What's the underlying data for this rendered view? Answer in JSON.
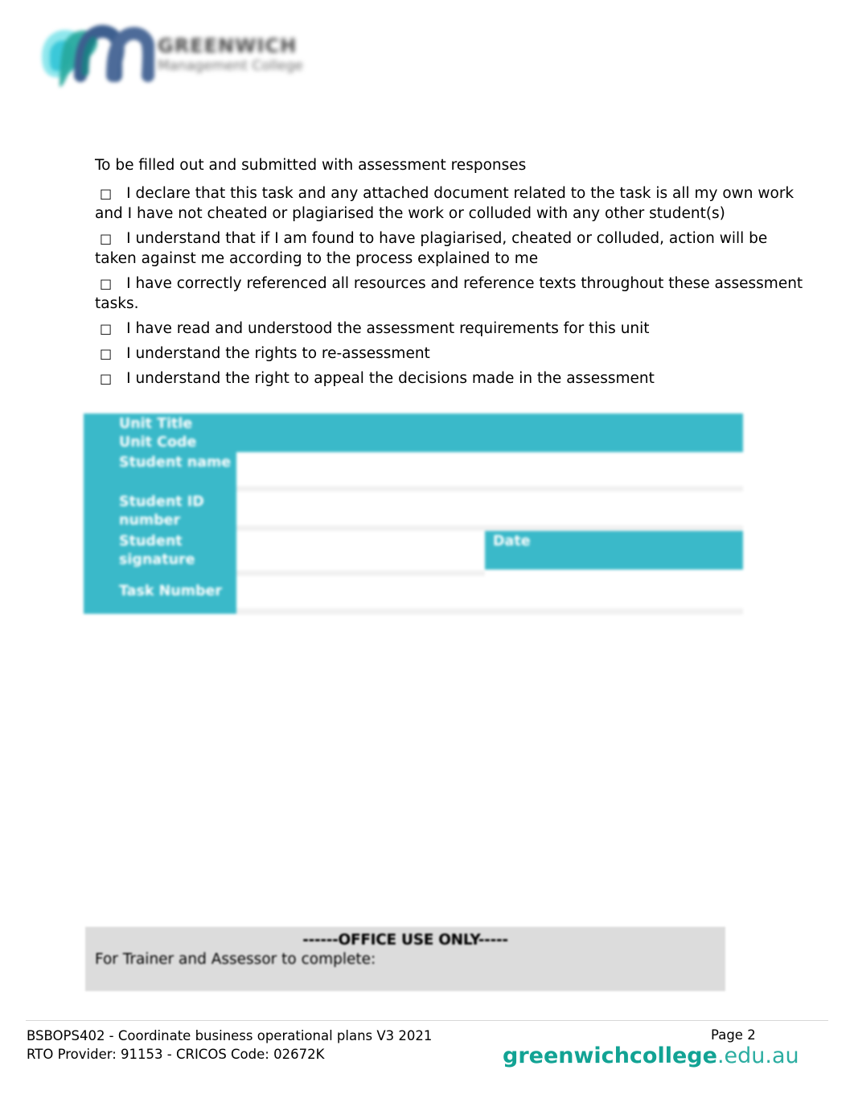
{
  "logo": {
    "mark_icon": "greenwich-gm-monogram-icon",
    "wordmark_top": "GREENWICH",
    "wordmark_bottom": "Management College",
    "colors": {
      "cyan": "#3fd2e0",
      "teal": "#2aa79b",
      "navy": "#49618c"
    }
  },
  "declaration": {
    "intro": "To be filled out and submitted with assessment responses",
    "checkbox_glyph": "□",
    "items": [
      "I declare that this task and any attached document related to the task is all my own work and I have not cheated or plagiarised the work or colluded with any other student(s)",
      "I understand that if I am found to have plagiarised, cheated or colluded, action will be taken against me according to the process explained to me",
      "I have correctly referenced all resources and reference texts throughout these assessment tasks.",
      "I have read and understood the assessment requirements for this unit",
      "I understand the rights to re-assessment",
      "I understand the right to appeal the decisions made in the assessment"
    ]
  },
  "details_table": {
    "accent_color": "#3ab9c9",
    "labels": {
      "unit_title": "Unit Title",
      "unit_code": "Unit Code",
      "student_name": "Student name",
      "student_id": "Student ID number",
      "student_signature": "Student signature",
      "date": "Date",
      "task_number": "Task Number"
    },
    "values": {
      "unit_title": "",
      "unit_code": "",
      "student_name": "",
      "student_id": "",
      "student_signature": "",
      "date": "",
      "task_number": "",
      "task_number_extra": ""
    }
  },
  "office_use": {
    "title": "------OFFICE USE ONLY-----",
    "subtitle": "For Trainer and Assessor to complete:"
  },
  "footer": {
    "unit_line": "BSBOPS402 - Coordinate business operational plans V3 2021",
    "rto_line": "RTO Provider: 91153  - CRICOS  Code: 02672K",
    "page_label": "Page 2",
    "url_bold": "greenwichcollege",
    "url_light": ".edu.au",
    "url_color": "#12a394"
  }
}
